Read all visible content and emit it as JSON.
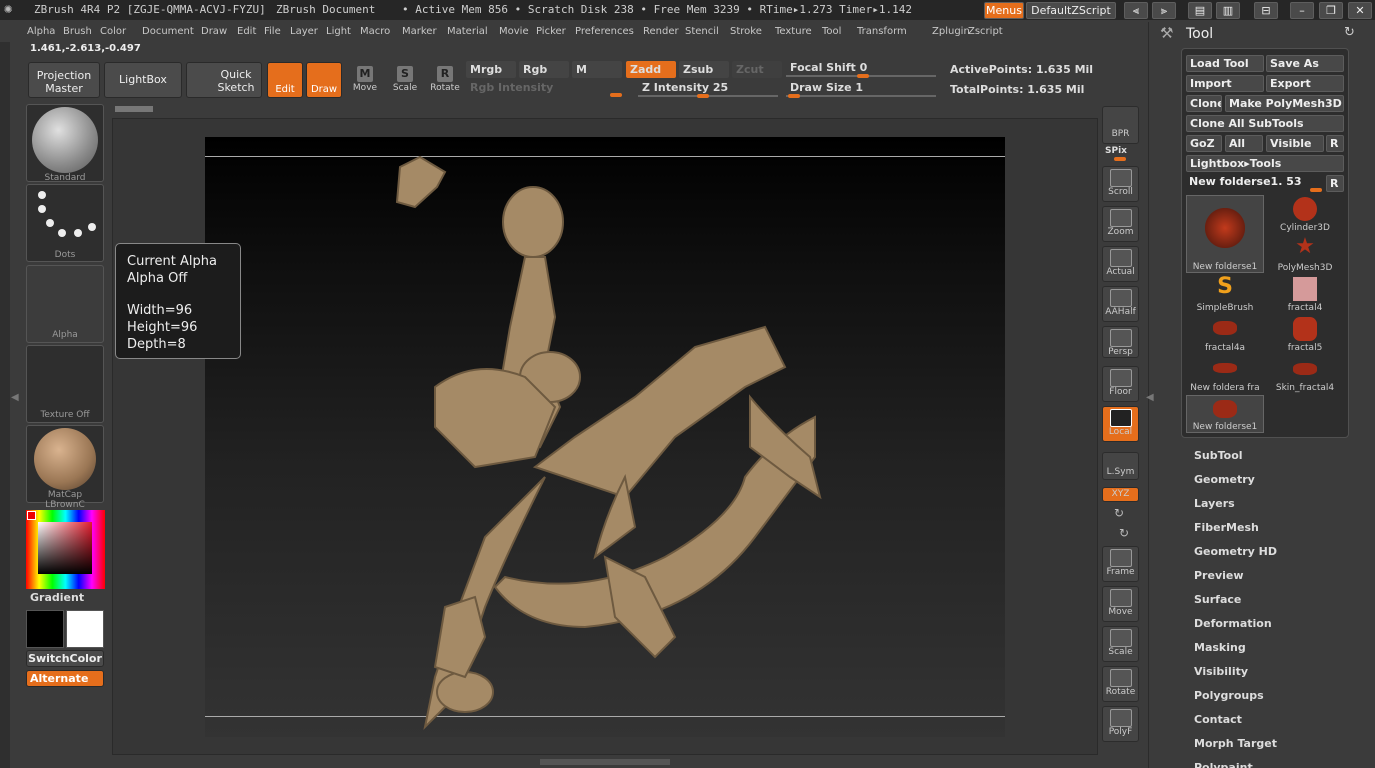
{
  "titlebar": {
    "app": "ZBrush 4R4 P2 [ZGJE-QMMA-ACVJ-FYZU]",
    "document": "ZBrush Document",
    "stats": "• Active Mem 856 • Scratch Disk 238 • Free Mem 3239 • RTime▸1.273 Timer▸1.142",
    "menus_btn": "Menus",
    "script_btn": "DefaultZScript"
  },
  "menu": [
    "Alpha",
    "Brush",
    "Color",
    "Document",
    "Draw",
    "Edit",
    "File",
    "Layer",
    "Light",
    "Macro",
    "Marker",
    "Material",
    "Movie",
    "Picker",
    "Preferences",
    "Render",
    "Stencil",
    "Stroke",
    "Texture",
    "Tool",
    "Transform",
    "Zplugin",
    "Zscript"
  ],
  "coords": "1.461,-2.613,-0.497",
  "toolbar": {
    "projection": "Projection Master",
    "lightbox": "LightBox",
    "quicksketch": "Quick Sketch",
    "edit": "Edit",
    "draw": "Draw",
    "move": "Move",
    "scale": "Scale",
    "rotate": "Rotate",
    "mrgb": "Mrgb",
    "rgb": "Rgb",
    "m": "M",
    "zadd": "Zadd",
    "zsub": "Zsub",
    "zcut": "Zcut",
    "rgb_intensity": "Rgb Intensity",
    "z_intensity": "Z Intensity 25",
    "focal_shift": "Focal Shift 0",
    "draw_size": "Draw Size 1",
    "active_points": "ActivePoints: 1.635 Mil",
    "total_points": "TotalPoints: 1.635 Mil"
  },
  "left": {
    "standard": "Standard",
    "dots": "Dots",
    "alpha": "Alpha",
    "texture": "Texture Off",
    "matcap": "MatCap LBrownC",
    "gradient": "Gradient",
    "switchcolor": "SwitchColor",
    "alternate": "Alternate"
  },
  "tooltip": {
    "line1": "Current Alpha",
    "line2": "Alpha Off",
    "line3": "Width=96",
    "line4": "Height=96",
    "line5": "Depth=8"
  },
  "righttools": {
    "bpr": "BPR",
    "spix": "SPix",
    "scroll": "Scroll",
    "zoom": "Zoom",
    "actual": "Actual",
    "aahalf": "AAHalf",
    "persp": "Persp",
    "floor": "Floor",
    "local": "Local",
    "lsym": "L.Sym",
    "xyz": "XYZ",
    "frame": "Frame",
    "move": "Move",
    "scale": "Scale",
    "rotate": "Rotate",
    "polyf": "PolyF"
  },
  "tool": {
    "title": "Tool",
    "load": "Load Tool",
    "saveas": "Save As",
    "import": "Import",
    "export": "Export",
    "clone": "Clone",
    "makepoly": "Make PolyMesh3D",
    "cloneall": "Clone All SubTools",
    "goz": "GoZ",
    "all": "All",
    "visible": "Visible",
    "r": "R",
    "lightbox_tools": "Lightbox▸Tools",
    "current": "New folderse1. 53",
    "thumbs": [
      "New folderse1",
      "Cylinder3D",
      "SimpleBrush",
      "PolyMesh3D",
      "fractal4a",
      "fractal4",
      "New foldera fra",
      "fractal5",
      "New folderse1",
      "Skin_fractal4"
    ]
  },
  "sections": [
    "SubTool",
    "Geometry",
    "Layers",
    "FiberMesh",
    "Geometry HD",
    "Preview",
    "Surface",
    "Deformation",
    "Masking",
    "Visibility",
    "Polygroups",
    "Contact",
    "Morph Target",
    "Polypaint"
  ],
  "colors": {
    "accent": "#e56e1c",
    "sculpt": "#a58a66"
  }
}
